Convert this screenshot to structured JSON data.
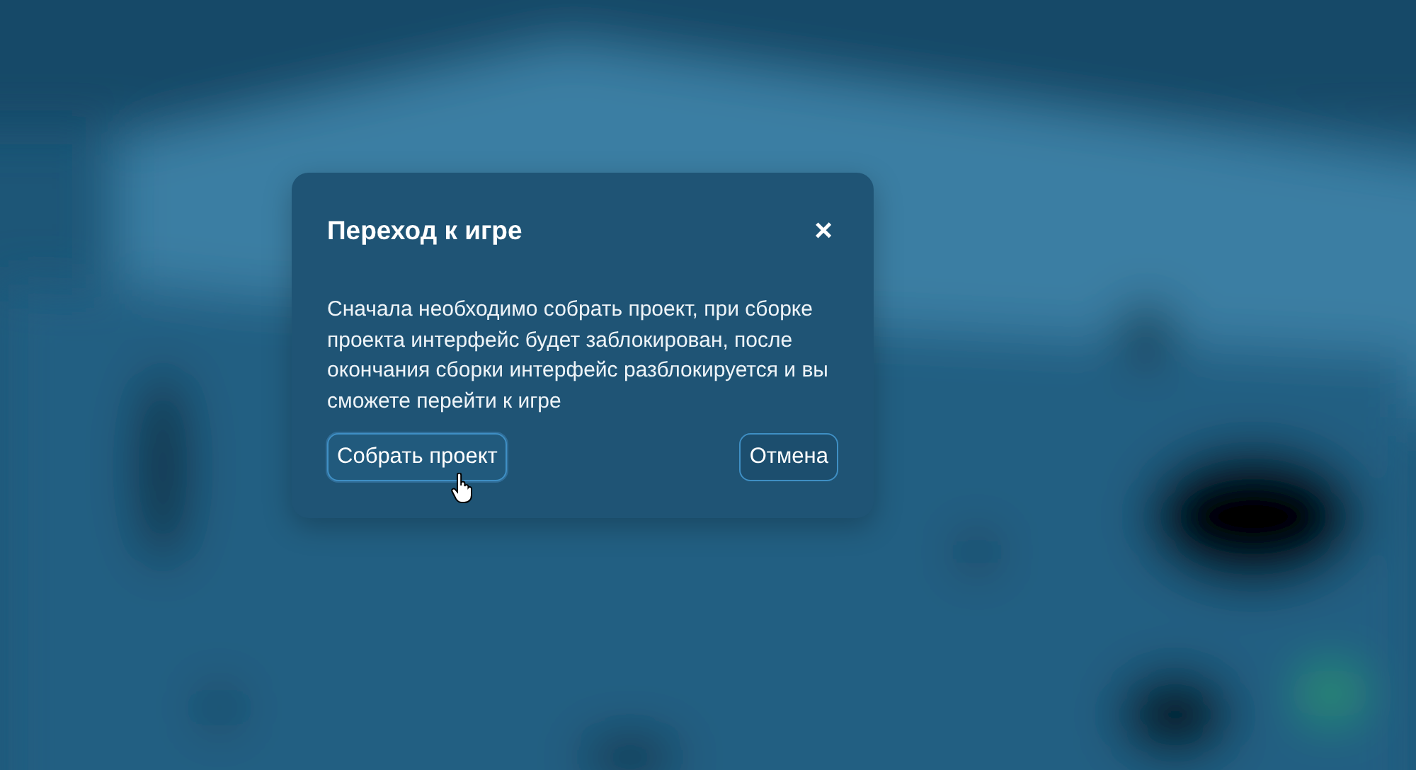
{
  "dialog": {
    "title": "Переход к игре",
    "close": "×",
    "message": "Сначала необходимо собрать проект, при сборке проекта интерфейс будет заблокирован, после окончания сборки интерфейс разблокируется и вы сможете перейти к игре",
    "buttons": [
      {
        "label": "Собрать проект",
        "hovered": true
      },
      {
        "label": "Отмена",
        "hovered": false
      }
    ]
  }
}
